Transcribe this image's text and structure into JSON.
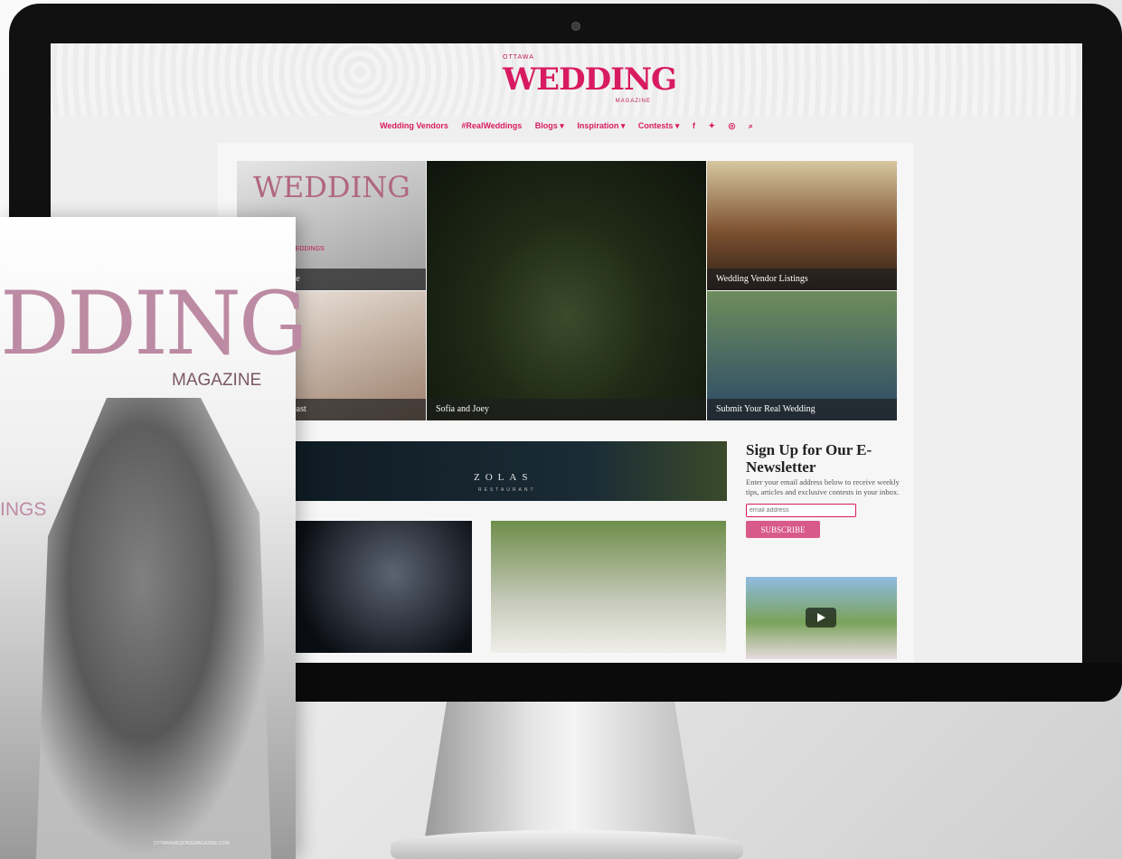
{
  "site": {
    "logo_small": "OTTAWA",
    "logo_main": "WEDDING",
    "logo_magazine": "MAGAZINE"
  },
  "nav": {
    "items": [
      "Wedding Vendors",
      "#RealWeddings",
      "Blogs ▾",
      "Inspiration ▾",
      "Contests ▾"
    ],
    "icons": [
      "facebook-icon",
      "twitter-icon",
      "instagram-icon",
      "search-icon"
    ]
  },
  "tiles": {
    "magazine": "ding Magazine",
    "vendor": "Wedding Vendor Listings",
    "feast": "y Wedding Feast",
    "couple": "Sofia and Joey",
    "submit": "Submit Your Real Wedding",
    "cover_title": "WEDDING",
    "cover_sub": "10 OTTAWA WEDDINGS"
  },
  "banner": {
    "name": "ZOLAS",
    "sub": "RESTAURANT"
  },
  "newsletter": {
    "title": "Sign Up for Our E-Newsletter",
    "body": "Enter your email address below to receive weekly tips, articles and exclusive contests in your inbox.",
    "placeholder": "email address",
    "button": "SUBSCRIBE"
  },
  "magazine": {
    "title": "DDING",
    "subtitle": "MAGAZINE",
    "partial": "INGS",
    "url": "OTTAWAWEDDINGMAGAZINE.COM"
  }
}
